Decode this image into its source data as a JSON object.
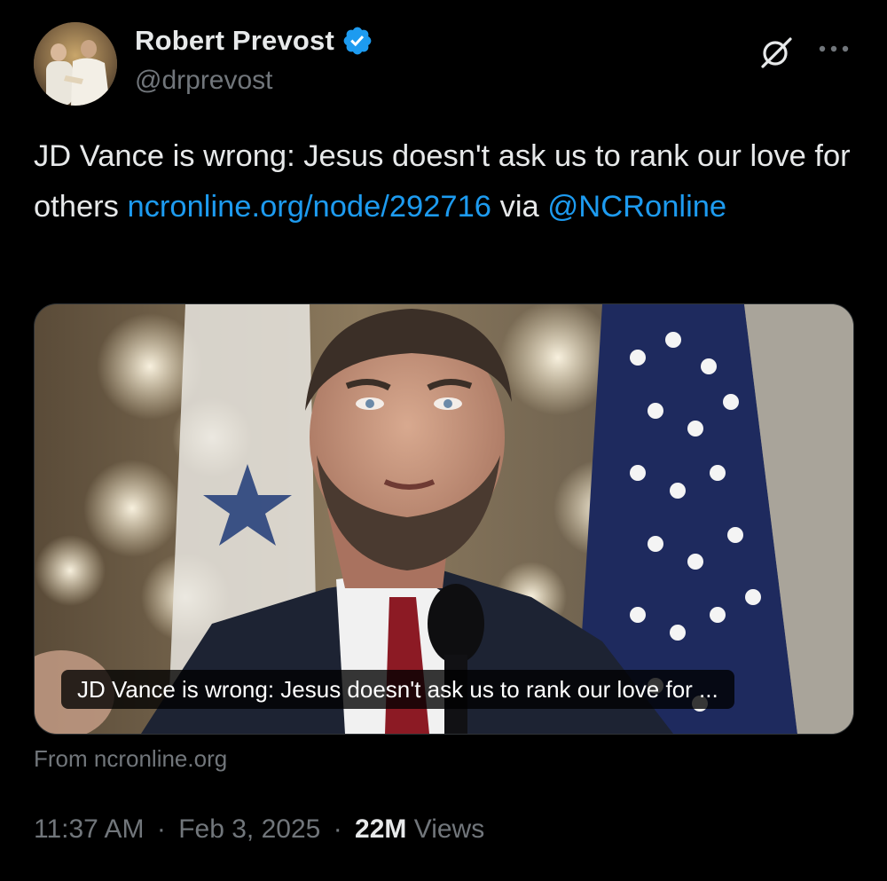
{
  "author": {
    "display_name": "Robert Prevost",
    "handle": "@drprevost",
    "verified_icon": "verified-badge-icon"
  },
  "header_actions": {
    "grok_icon": "grok-icon",
    "more_icon": "more-horizontal-icon"
  },
  "tweet": {
    "text_part1": "JD Vance is wrong: Jesus doesn't ask us to rank our love for others ",
    "link_url_text": "ncronline.org/node/292716",
    "text_part2": " via ",
    "mention": "@NCRonline"
  },
  "card": {
    "caption": "JD Vance is wrong: Jesus doesn't ask us to rank our love for ...",
    "source": "From ncronline.org"
  },
  "meta": {
    "time": "11:37 AM",
    "separator": "·",
    "date": "Feb 3, 2025",
    "views_count": "22M",
    "views_label": "Views"
  },
  "colors": {
    "background": "#000000",
    "text_primary": "#e7e9ea",
    "text_secondary": "#71767b",
    "link": "#1d9bf0",
    "verified": "#1d9bf0"
  }
}
